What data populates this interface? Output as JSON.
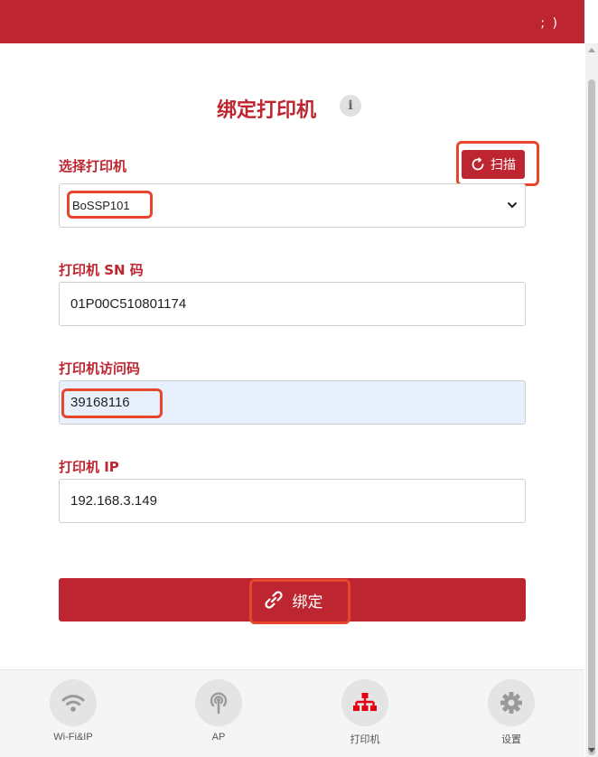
{
  "header": {
    "right_text": "; )"
  },
  "title": {
    "text": "绑定打印机",
    "info_icon": "i"
  },
  "printer_select": {
    "label": "选择打印机",
    "value": "BoSSP101",
    "scan_label": "扫描"
  },
  "sn": {
    "label": "打印机 SN 码",
    "value": "01P00C510801174"
  },
  "access_code": {
    "label": "打印机访问码",
    "value": "39168116"
  },
  "ip": {
    "label": "打印机 IP",
    "value": "192.168.3.149"
  },
  "bind_button": {
    "label": "绑定"
  },
  "nav": [
    {
      "label": "Wi-Fi&IP",
      "icon": "wifi-icon"
    },
    {
      "label": "AP",
      "icon": "antenna-icon"
    },
    {
      "label": "打印机",
      "icon": "printer-network-icon"
    },
    {
      "label": "设置",
      "icon": "gear-icon"
    }
  ],
  "colors": {
    "accent": "#bd2630",
    "highlight": "#e8462c",
    "nav_bg": "#f5f5f5",
    "active_icon": "#e60012",
    "inactive_icon": "#9a9a9a"
  }
}
